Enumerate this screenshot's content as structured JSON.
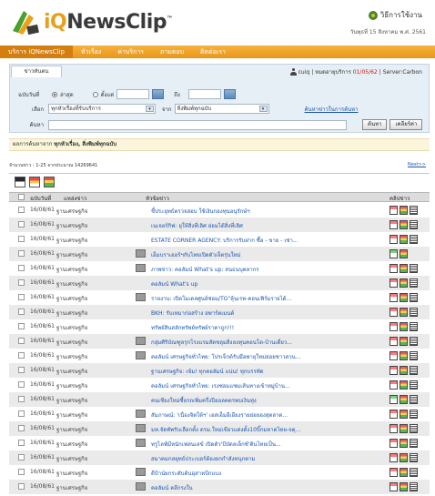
{
  "header": {
    "logo_text_pre": "iQ",
    "logo_text_post": "NewsClip",
    "logo_tm": "™",
    "howto_label": "วิธีการใช้งาน",
    "date_text": "วันพุธที่ 15 สิงหาคม พ.ศ. 2561"
  },
  "nav": {
    "items": [
      "บริการ iQNewsClip",
      "หัวเรื่อง",
      "ค่าบริการ",
      "ถามตอบ",
      "ติดต่อเรา"
    ],
    "active_index": 0
  },
  "panel": {
    "tab_label": "ข่าวทันตน",
    "user_label": "cuiq",
    "expiry_prefix": "หมดอายุบริการ",
    "expiry_date": "01/05/62",
    "server_label": "Server:Carbon",
    "date_label": "ฉบับวันที่",
    "radio_latest": "ล่าสุด",
    "radio_since": "ตั้งแต่",
    "to_label": "ถึง",
    "select_label": "เลือก",
    "topic_value": "ทุกหัวเรื่องที่รับบริการ",
    "from_label": "จาก",
    "source_value": "สิ่งพิมพ์ทุกฉบับ",
    "advanced_link": "ค้นหาข่าวในการค้นหา",
    "search_label": "ค้นหา",
    "search_value": "",
    "search_button": "ค้นหา",
    "clear_button": "เคลียร์ค่า"
  },
  "results": {
    "summary_prefix": "ผลการค้นหาจาก",
    "summary_value": "ทุกหัวเรื่อง, สิ่งพิมพ์ทุกฉบับ",
    "count_text": "จำนวนข่าว : 1-25  จากประมาณ 14269641",
    "next_link": "Next>>"
  },
  "table": {
    "col_date": "ฉบับวันที่",
    "col_source": "แหล่งข่าว",
    "col_headline": "หัวข้อข่าว",
    "col_clip": "คลิปข่าว",
    "rows": [
      {
        "date": "16/08/61",
        "source": "ฐานเศรษฐกิจ",
        "headline": "ชี้ประยุทธ์ตรวจสอบ ใช้เงินกองทุนอนุรักษ์ฯ",
        "img": false,
        "icons": [
          "pdf",
          "ppt",
          "txt"
        ]
      },
      {
        "date": "16/08/61",
        "source": "ฐานเศรษฐกิจ",
        "headline": "เนเจอร์กิฟ: ยุให้สิ่งที่เลิศ ย่อมได้สิ่งที่เลิศ",
        "img": false,
        "icons": [
          "pdf",
          "ppt",
          "txt"
        ]
      },
      {
        "date": "16/08/61",
        "source": "ฐานเศรษฐกิจ",
        "headline": "ESTATE CORNER AGENCY: บริการรับฝาก ซื้อ - ขาย - เช่า...",
        "img": false,
        "icons": [
          "pdf",
          "ppt",
          "txt"
        ]
      },
      {
        "date": "16/08/61",
        "source": "ฐานเศรษฐกิจ",
        "headline": "เอ็มบราเออร์ฯกับไทยเปิดตัวเจ็ตรุ่นใหม่",
        "img": true,
        "icons": [
          "pdf g",
          "ppt"
        ]
      },
      {
        "date": "16/08/61",
        "source": "ฐานเศรษฐกิจ",
        "headline": "ภาพข่าว: คอลัมน์ What's up: สนธนบุคลากร",
        "img": true,
        "icons": [
          "pdf",
          "ppt",
          "txt"
        ]
      },
      {
        "date": "16/08/61",
        "source": "ฐานเศรษฐกิจ",
        "headline": "คอลัมน์ What's up",
        "img": false,
        "icons": [
          "pdf",
          "ppt",
          "txt"
        ]
      },
      {
        "date": "16/08/61",
        "source": "ฐานเศรษฐกิจ",
        "headline": "รายงาน: เปิดโมเดลศูนย์ซ่อม/TG\"ลุ้นเรท-คอนเฟิร์มรายได้...",
        "img": true,
        "icons": [
          "pdf",
          "ppt",
          "txt"
        ]
      },
      {
        "date": "16/08/61",
        "source": "ฐานเศรษฐกิจ",
        "headline": "BKH: รับเหมาก่อสร้าง อพาร์ตเมนต์",
        "img": false,
        "icons": [
          "pdf",
          "ppt",
          "txt"
        ]
      },
      {
        "date": "16/08/61",
        "source": "ฐานเศรษฐกิจ",
        "headline": "ทรัพย์สินสลักทรัพย์ทรัพย์ราคาถูก!!!",
        "img": false,
        "icons": [
          "pdf",
          "ppt",
          "txt"
        ]
      },
      {
        "date": "16/08/61",
        "source": "ฐานเศรษฐกิจ",
        "headline": "กลุ่มศิริบัณฑูลรุกโรงแรมสัดชลุมสิ่งลงทุนคอนโด-บ้านเดี่ยว...",
        "img": true,
        "icons": [
          "pdf",
          "ppt",
          "txt"
        ]
      },
      {
        "date": "16/08/61",
        "source": "ฐานเศรษฐกิจ",
        "headline": "คอลัมน์ เศรษฐกิจทั่วไทย: โปรเจ็กต์รับมือพายุใหม่ย่อยชาวสวน...",
        "img": true,
        "icons": [
          "pdf",
          "ppt",
          "txt"
        ]
      },
      {
        "date": "16/08/61",
        "source": "ฐานเศรษฐกิจ",
        "headline": "ฐานเศรษฐกิจ: เข้ม! ทุกคอลัมน์ แน่น! ทุกบรรทัด",
        "img": false,
        "icons": [
          "pdf",
          "ppt",
          "txt"
        ]
      },
      {
        "date": "16/08/61",
        "source": "ฐานเศรษฐกิจ",
        "headline": "คอลัมน์ เศรษฐกิจทั่วไทย: เรงซ่อมแซมเส้นทางเข้าหมู่บ้าน...",
        "img": false,
        "icons": [
          "pdf",
          "ppt",
          "txt"
        ]
      },
      {
        "date": "16/08/61",
        "source": "ฐานเศรษฐกิจ",
        "headline": "คนเชียงใหม่ซื้อรถเพิ่มครึ่งปีออลคตรพบเงินทุ่ง",
        "img": false,
        "icons": [
          "pdf g",
          "ppt",
          "txt"
        ]
      },
      {
        "date": "16/08/61",
        "source": "ฐานเศรษฐกิจ",
        "headline": "สัมภาษณ์: 'เนื่องจิตใต้ฯ' เอสเอ็มอีเอียงรายย่อยองสุดลาด...",
        "img": true,
        "icons": [
          "pdf",
          "ppt",
          "txt"
        ]
      },
      {
        "date": "16/08/61",
        "source": "ฐานเศรษฐกิจ",
        "headline": "มท.จัดทัพรับเลือกตั้ง ตรม.ใหม่เขียวแต่งตั้ง10บิ๊กมหาดไทย-จตุ...",
        "img": true,
        "icons": [
          "pdf",
          "ppt",
          "txt"
        ]
      },
      {
        "date": "16/08/61",
        "source": "ฐานเศรษฐกิจ",
        "headline": "ทรูไลฟ์มีหนักเฟล่นเลข์ เปิดตัว'บีบัดลเล็กซ์'ตินไทยเป็น...",
        "img": true,
        "icons": [
          "pdf",
          "ppt",
          "txt"
        ]
      },
      {
        "date": "16/08/61",
        "source": "ฐานเศรษฐกิจ",
        "headline": "สมาคมกลยุทธ์ประเบอร์ต้องยกกำลังหนุกตาม",
        "img": false,
        "icons": [
          "pdf",
          "ppt",
          "txt"
        ]
      },
      {
        "date": "16/08/61",
        "source": "ฐานเศรษฐกิจ",
        "headline": "ดีป้าน์ยกระดับด้นอุสาหบีกแบง",
        "img": true,
        "icons": [
          "pdf",
          "ppt",
          "txt"
        ]
      },
      {
        "date": "16/08/61",
        "source": "ฐานเศรษฐกิจ",
        "headline": "คอลัมน์ คลีกรงใน",
        "img": true,
        "icons": [
          "pdf",
          "ppt",
          "txt"
        ]
      }
    ]
  },
  "colors": {
    "nav_orange": "#f7b23b",
    "link_blue": "#1a55b0",
    "panel_blue": "#e6eef6",
    "expiry_red": "#d01515"
  }
}
